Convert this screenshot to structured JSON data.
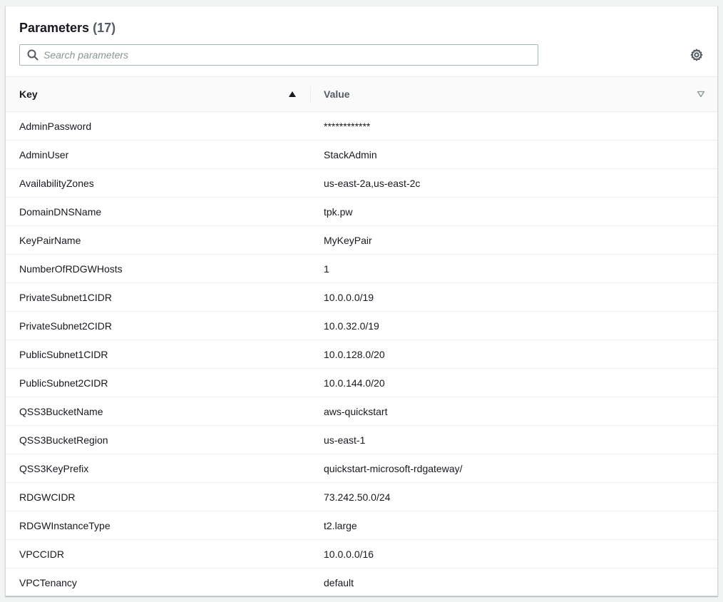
{
  "header": {
    "title": "Parameters",
    "count": "(17)",
    "search_placeholder": "Search parameters"
  },
  "icons": {
    "search": "search-icon",
    "settings": "gear-icon",
    "sort_ascending": "caret-up-filled-icon",
    "sort_unsorted": "caret-down-outline-icon"
  },
  "table": {
    "columns": [
      "Key",
      "Value"
    ],
    "sorted_column": "Key",
    "sort_direction": "ascending",
    "rows": [
      {
        "key": "AdminPassword",
        "value": "************"
      },
      {
        "key": "AdminUser",
        "value": "StackAdmin"
      },
      {
        "key": "AvailabilityZones",
        "value": "us-east-2a,us-east-2c"
      },
      {
        "key": "DomainDNSName",
        "value": "tpk.pw"
      },
      {
        "key": "KeyPairName",
        "value": "MyKeyPair"
      },
      {
        "key": "NumberOfRDGWHosts",
        "value": "1"
      },
      {
        "key": "PrivateSubnet1CIDR",
        "value": "10.0.0.0/19"
      },
      {
        "key": "PrivateSubnet2CIDR",
        "value": "10.0.32.0/19"
      },
      {
        "key": "PublicSubnet1CIDR",
        "value": "10.0.128.0/20"
      },
      {
        "key": "PublicSubnet2CIDR",
        "value": "10.0.144.0/20"
      },
      {
        "key": "QSS3BucketName",
        "value": "aws-quickstart"
      },
      {
        "key": "QSS3BucketRegion",
        "value": "us-east-1"
      },
      {
        "key": "QSS3KeyPrefix",
        "value": "quickstart-microsoft-rdgateway/"
      },
      {
        "key": "RDGWCIDR",
        "value": "73.242.50.0/24"
      },
      {
        "key": "RDGWInstanceType",
        "value": "t2.large"
      },
      {
        "key": "VPCCIDR",
        "value": "10.0.0.0/16"
      },
      {
        "key": "VPCTenancy",
        "value": "default"
      }
    ]
  },
  "colors": {
    "page_background": "#f2f3f3",
    "panel_background": "#ffffff",
    "header_row_background": "#fafafa",
    "border": "#eaeded",
    "text": "#16191f",
    "muted_text": "#545b64",
    "placeholder": "#879596"
  }
}
